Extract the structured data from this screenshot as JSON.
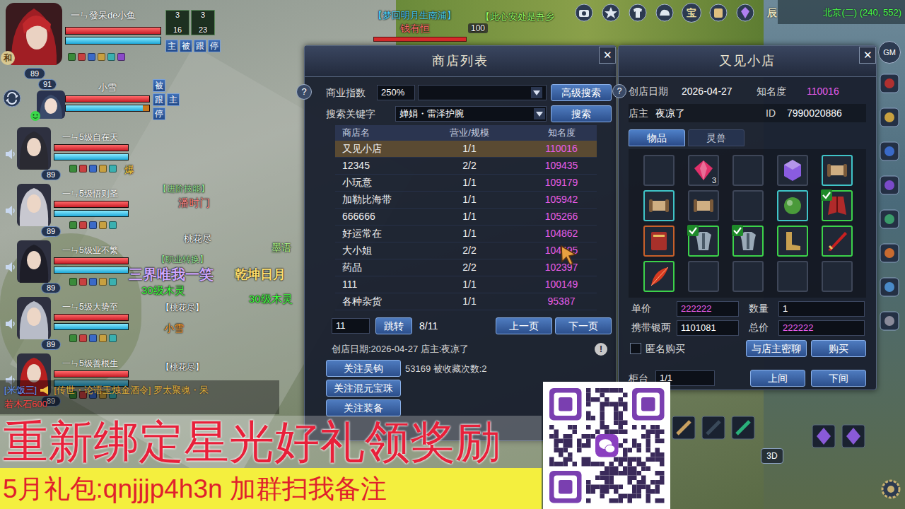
{
  "hud": {
    "leader": {
      "side_tag": "和",
      "name": "一ㄣ發呆de小鱼",
      "level": "89",
      "hp": 1,
      "mp": 1,
      "status_counts": [
        {
          "top": "3",
          "bottom": "16"
        },
        {
          "top": "3",
          "bottom": "23"
        }
      ],
      "buttons": [
        "主",
        "被",
        "跟",
        "停"
      ]
    },
    "pet": {
      "name": "小雪",
      "level": "91",
      "hp": 1,
      "mp": 0.92,
      "buttons": [
        "被",
        "跟",
        "主",
        "停"
      ]
    },
    "members": [
      {
        "name": "一ㄣ5级自在天",
        "level": "89",
        "hp": 1,
        "mp": 1
      },
      {
        "name": "一ㄣ5级悟则圣",
        "level": "89",
        "hp": 1,
        "mp": 1
      },
      {
        "name": "一ㄣ5级业不繁",
        "level": "89",
        "hp": 1,
        "mp": 1
      },
      {
        "name": "一ㄣ5级大势至",
        "level": "89",
        "hp": 1,
        "mp": 1
      },
      {
        "name": "一ㄣ5级善根生",
        "level": "89",
        "hp": 1,
        "mp": 1
      }
    ]
  },
  "toolbar": {
    "treasure": "宝",
    "hour": "辰",
    "location": "北京(二) (240, 552)",
    "gm": "GM",
    "view_mode": "3D"
  },
  "world_labels": [
    {
      "text": "【梦回明月生南浦】",
      "color": "#4fd8ff"
    },
    {
      "text": "钱有恒",
      "color": "#ff6a6a"
    },
    {
      "text": "100",
      "color": "#ffffff"
    },
    {
      "text": "【此心安处是吾乡",
      "color": "#9aff6a"
    },
    {
      "text": "【进阶技能】",
      "color": "#9ae89a"
    },
    {
      "text": "爆",
      "color": "#ffd040"
    },
    {
      "text": "潘时门",
      "color": "#ff8a8a"
    },
    {
      "text": "桃花尽",
      "color": "#ffffff"
    },
    {
      "text": "墨语",
      "color": "#b8ff90"
    },
    {
      "text": "【职业转换】",
      "color": "#9ae89a"
    },
    {
      "text": "三界唯我一笑",
      "color": "#d0a8ff"
    },
    {
      "text": "乾坤日月",
      "color": "#ffe070"
    },
    {
      "text": "30级木灵",
      "color": "#40ff40"
    },
    {
      "text": "30级木灵",
      "color": "#40ff40"
    },
    {
      "text": "【桃花尽】",
      "color": "#ffffff"
    },
    {
      "text": "小雪",
      "color": "#ffa030"
    },
    {
      "text": "【桃花尽】",
      "color": "#ffffff"
    }
  ],
  "shop_list": {
    "title": "商店列表",
    "close": "✕",
    "help": "?",
    "index_label": "商业指数",
    "index_value": "250%",
    "advanced_search": "高级搜索",
    "keyword_label": "搜索关键字",
    "keyword_value": "婵娟・雷泽护腕",
    "search": "搜索",
    "columns": [
      "商店名",
      "营业/规模",
      "知名度"
    ],
    "rows": [
      {
        "name": "又见小店",
        "scale": "1/1",
        "fame": "110016",
        "selected": true
      },
      {
        "name": "12345",
        "scale": "2/2",
        "fame": "109435",
        "selected": false
      },
      {
        "name": "小玩意",
        "scale": "1/1",
        "fame": "109179",
        "selected": false
      },
      {
        "name": "加勒比海带",
        "scale": "1/1",
        "fame": "105942",
        "selected": false
      },
      {
        "name": "666666",
        "scale": "1/1",
        "fame": "105266",
        "selected": false
      },
      {
        "name": "好运常在",
        "scale": "1/1",
        "fame": "104862",
        "selected": false
      },
      {
        "name": "大小姐",
        "scale": "2/2",
        "fame": "104495",
        "selected": false
      },
      {
        "name": "药品",
        "scale": "2/2",
        "fame": "102397",
        "selected": false
      },
      {
        "name": "111",
        "scale": "1/1",
        "fame": "100149",
        "selected": false
      },
      {
        "name": "各种杂货",
        "scale": "1/1",
        "fame": "95387",
        "selected": false
      }
    ],
    "page_input": "11",
    "jump": "跳转",
    "page": "8/11",
    "prev": "上一页",
    "next": "下一页",
    "info": "创店日期:2026-04-27 店主:夜凉了",
    "info2": "53169 被收藏次数:2",
    "notice": "!",
    "follow_buttons": [
      "关注吴钩",
      "关注混元宝珠",
      "关注装备"
    ]
  },
  "shop": {
    "title": "又见小店",
    "close": "✕",
    "help": "?",
    "date_label": "创店日期",
    "date": "2026-04-27",
    "fame_label": "知名度",
    "fame": "110016",
    "owner_label": "店主",
    "owner": "夜凉了",
    "id_label": "ID",
    "id": "7990020886",
    "tabs": [
      {
        "label": "物品",
        "selected": true
      },
      {
        "label": "灵兽",
        "selected": false
      }
    ],
    "items": [
      {
        "kind": "empty",
        "frame": "#3e4658",
        "checked": false
      },
      {
        "kind": "gem",
        "color": "#e0306a",
        "frame": "#3e4658",
        "checked": false,
        "count": "3"
      },
      {
        "kind": "empty",
        "frame": "#3e4658",
        "checked": false
      },
      {
        "kind": "crystal",
        "color": "#8a5ce0",
        "frame": "#3e4658",
        "checked": false
      },
      {
        "kind": "scroll",
        "color": "#cfae82",
        "frame": "#3fc4c8",
        "checked": false
      },
      {
        "kind": "scroll",
        "color": "#cfae82",
        "frame": "#3fc4c8",
        "checked": false
      },
      {
        "kind": "scroll",
        "color": "#cfae82",
        "frame": "#3e4658",
        "checked": false
      },
      {
        "kind": "empty",
        "frame": "#3e4658",
        "checked": false
      },
      {
        "kind": "orb",
        "color": "#4a9a3a",
        "frame": "#3fc4c8",
        "checked": false
      },
      {
        "kind": "cloak",
        "color": "#b02a2a",
        "frame": "#3cd24a",
        "checked": true
      },
      {
        "kind": "book",
        "color": "#a8302a",
        "frame": "#c8602a",
        "checked": false
      },
      {
        "kind": "armor",
        "color": "#9aaab8",
        "frame": "#3cd24a",
        "checked": true
      },
      {
        "kind": "armor",
        "color": "#9aaab8",
        "frame": "#3cd24a",
        "checked": true
      },
      {
        "kind": "boots",
        "color": "#c8a050",
        "frame": "#3cd24a",
        "checked": false
      },
      {
        "kind": "blade",
        "color": "#c82020",
        "frame": "#3cd24a",
        "checked": false
      },
      {
        "kind": "feather",
        "color": "#d83a20",
        "frame": "#3cd24a",
        "checked": false
      },
      {
        "kind": "empty",
        "frame": "#3e4658",
        "checked": false
      },
      {
        "kind": "empty",
        "frame": "#3e4658",
        "checked": false
      },
      {
        "kind": "empty",
        "frame": "#3e4658",
        "checked": false
      },
      {
        "kind": "empty",
        "frame": "#3e4658",
        "checked": false
      }
    ],
    "price_label": "单价",
    "price": "222222",
    "qty_label": "数量",
    "qty": "1",
    "silver_label": "携带银两",
    "silver": "1101081",
    "total_label": "总价",
    "total": "222222",
    "anonymous": {
      "label": "匿名购买",
      "checked": false
    },
    "chat": "与店主密聊",
    "buy": "购买",
    "counter_label": "柜台",
    "counter": "1/1",
    "prev": "上间",
    "next": "下间"
  },
  "chat": {
    "lines": [
      {
        "segments": [
          {
            "text": "[米饭三]",
            "color": "#6a9aff"
          },
          {
            "text": "[传世・论语玉烛金酒令]",
            "color": "#e0b040"
          },
          {
            "text": "罗太聚魂・呆",
            "color": "#e0b040"
          }
        ]
      },
      {
        "segments": [
          {
            "text": "若木石600",
            "color": "#ff4a4a"
          }
        ]
      }
    ]
  },
  "banner": {
    "line1": "重新绑定星光好礼领奖励",
    "line2": "5月礼包:qnjjjp4h3n 加群扫我备注"
  }
}
